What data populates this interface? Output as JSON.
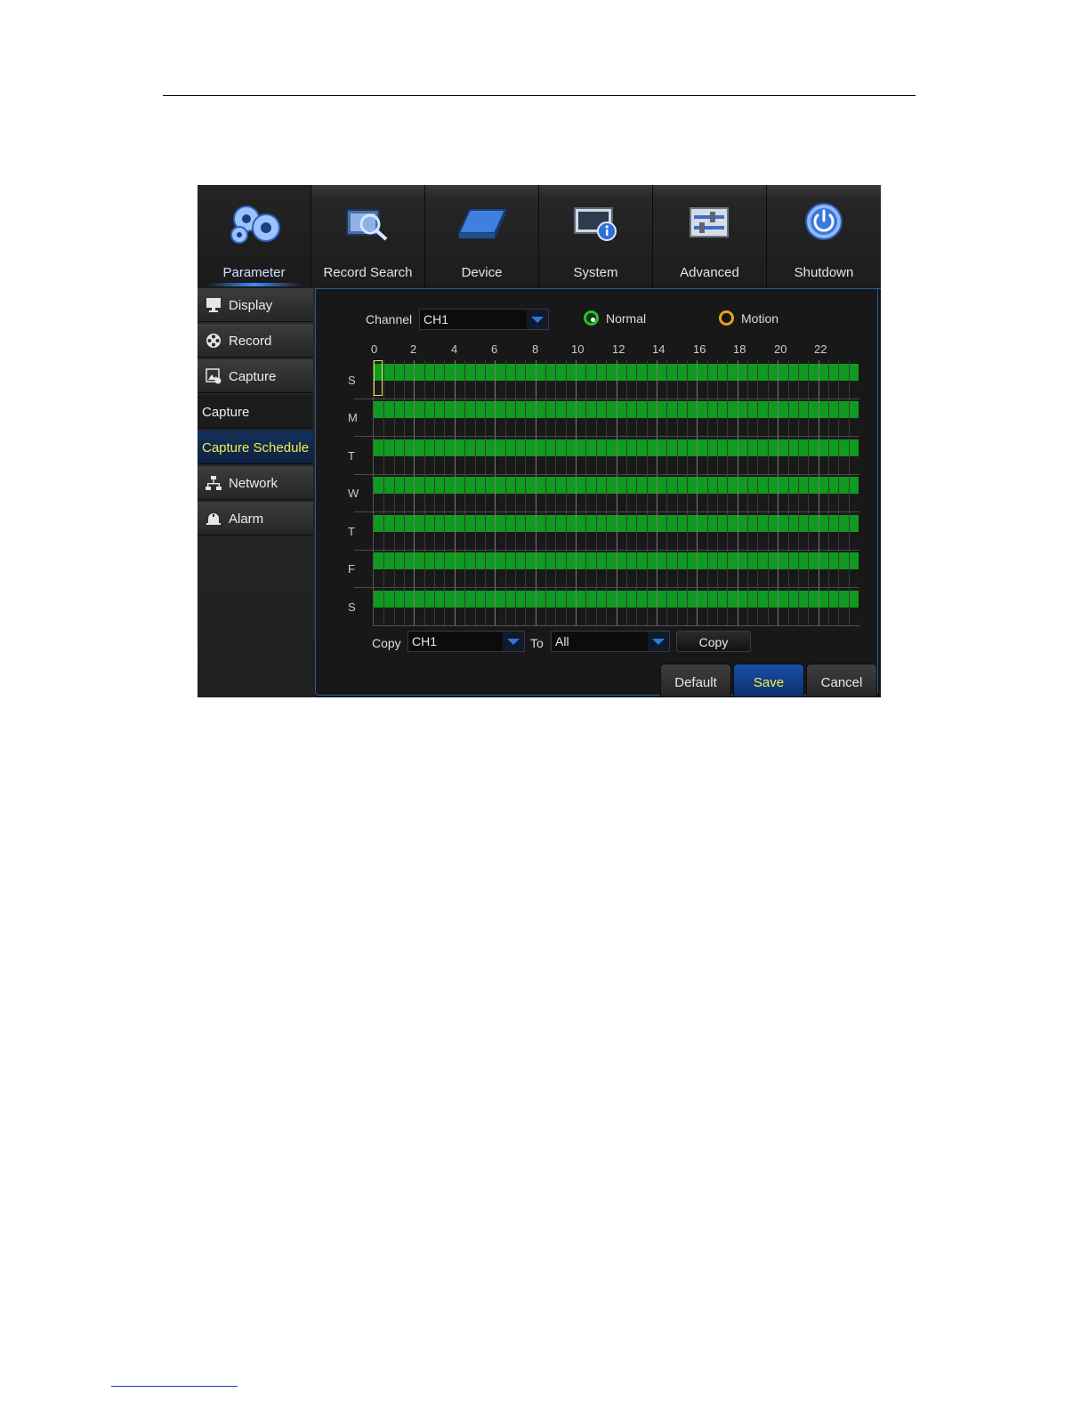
{
  "nav": {
    "tabs": [
      {
        "label": "Parameter",
        "icon": "gears-icon",
        "active": true
      },
      {
        "label": "Record Search",
        "icon": "film-search-icon",
        "active": false
      },
      {
        "label": "Device",
        "icon": "hard-drive-icon",
        "active": false
      },
      {
        "label": "System",
        "icon": "monitor-info-icon",
        "active": false
      },
      {
        "label": "Advanced",
        "icon": "sliders-icon",
        "active": false
      },
      {
        "label": "Shutdown",
        "icon": "power-icon",
        "active": false
      }
    ]
  },
  "sidebar": {
    "items": [
      {
        "label": "Display",
        "icon": "monitor-icon"
      },
      {
        "label": "Record",
        "icon": "film-reel-icon"
      },
      {
        "label": "Capture",
        "icon": "image-capture-icon"
      },
      {
        "label": "Capture",
        "icon": ""
      },
      {
        "label": "Capture Schedule",
        "icon": "",
        "current": true
      },
      {
        "label": "Network",
        "icon": "network-icon"
      },
      {
        "label": "Alarm",
        "icon": "alarm-bell-icon"
      }
    ]
  },
  "schedule": {
    "channel_label": "Channel",
    "channel_value": "CH1",
    "mode_normal": "Normal",
    "mode_motion": "Motion",
    "mode_selected": "Normal",
    "hours": [
      "0",
      "2",
      "4",
      "6",
      "8",
      "10",
      "12",
      "14",
      "16",
      "18",
      "20",
      "22"
    ],
    "days": [
      "S",
      "M",
      "T",
      "W",
      "T",
      "F",
      "S"
    ],
    "normal_color": "#0f9a20",
    "motion_color": "#e8a020"
  },
  "copy": {
    "label": "Copy",
    "from_value": "CH1",
    "to_label": "To",
    "to_value": "All",
    "button": "Copy"
  },
  "buttons": {
    "default": "Default",
    "save": "Save",
    "cancel": "Cancel"
  }
}
